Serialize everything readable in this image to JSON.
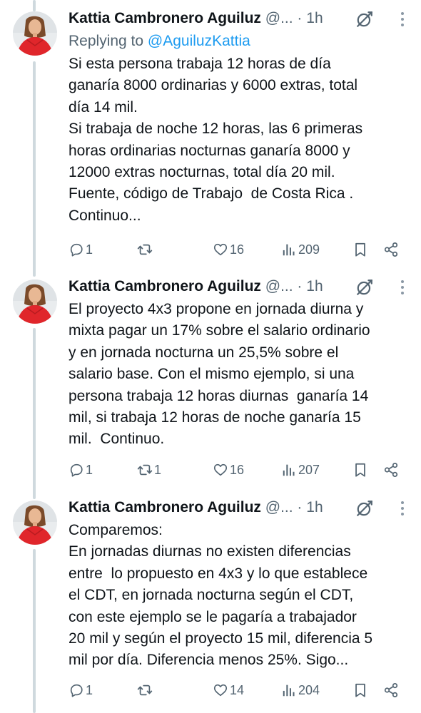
{
  "tweets": [
    {
      "author": "Kattia Cambronero Aguiluz",
      "handle": "@...",
      "dot": "·",
      "time": "1h",
      "reply_prefix": "Replying to ",
      "reply_handle": "@AguiluzKattia",
      "text": "Si esta persona trabaja 12 horas de día\nganaría 8000 ordinarias y 6000 extras, total\ndía 14 mil.\nSi trabaja de noche 12 horas, las 6 primeras\nhoras ordinarias nocturnas ganaría 8000 y\n12000 extras nocturnas, total día 20 mil.\nFuente, código de Trabajo  de Costa Rica .\nContinuo...",
      "replies": "1",
      "retweets": "",
      "likes": "16",
      "views": "209"
    },
    {
      "author": "Kattia Cambronero Aguiluz",
      "handle": "@...",
      "dot": "·",
      "time": "1h",
      "text": "El proyecto 4x3 propone en jornada diurna y\nmixta pagar un 17% sobre el salario ordinario\ny en jornada nocturna un 25,5% sobre el\nsalario base. Con el mismo ejemplo, si una\npersona trabaja 12 horas diurnas  ganaría 14\nmil, si trabaja 12 horas de noche ganaría 15\nmil.  Continuo.",
      "replies": "1",
      "retweets": "1",
      "likes": "16",
      "views": "207"
    },
    {
      "author": "Kattia Cambronero Aguiluz",
      "handle": "@...",
      "dot": "·",
      "time": "1h",
      "text": "Comparemos:\nEn jornadas diurnas no existen diferencias\nentre  lo propuesto en 4x3 y lo que establece\nel CDT, en jornada nocturna según el CDT,\ncon este ejemplo se le pagaría a trabajador\n20 mil y según el proyecto 15 mil, diferencia 5\nmil por día. Diferencia menos 25%. Sigo...",
      "replies": "1",
      "retweets": "",
      "likes": "14",
      "views": "204"
    }
  ],
  "colors": {
    "text": "#0f1419",
    "muted": "#536471",
    "link": "#1d9bf0",
    "thread": "#cfd9de",
    "dress": "#e0262b"
  },
  "icons": [
    "avatar-photo",
    "grok-icon",
    "more-icon",
    "reply-icon",
    "retweet-icon",
    "like-icon",
    "views-icon",
    "bookmark-icon",
    "share-icon"
  ]
}
